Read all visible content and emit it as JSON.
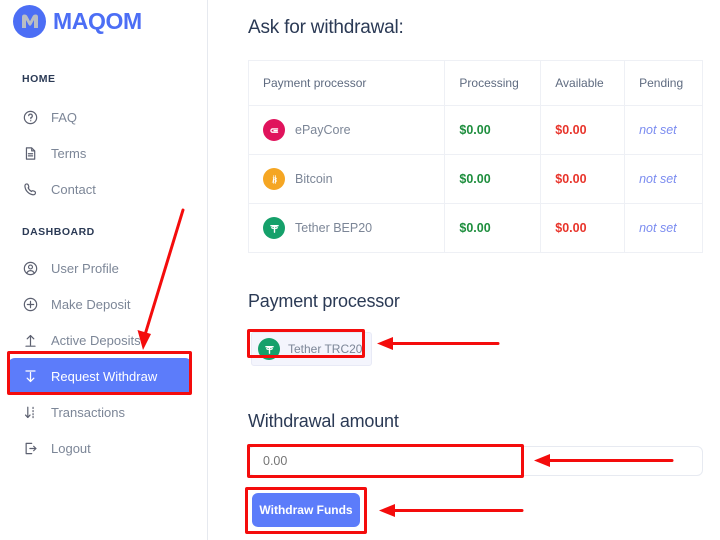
{
  "brand": {
    "name": "MAQOM",
    "logo_icon": "maqom-circle-m-logo",
    "color": "#4c6ef5"
  },
  "sidebar": {
    "sections": [
      {
        "label": "HOME",
        "items": [
          {
            "label": "FAQ",
            "icon": "question-circle-icon",
            "active": false
          },
          {
            "label": "Terms",
            "icon": "document-icon",
            "active": false
          },
          {
            "label": "Contact",
            "icon": "phone-icon",
            "active": false
          }
        ]
      },
      {
        "label": "DASHBOARD",
        "items": [
          {
            "label": "User Profile",
            "icon": "user-circle-icon",
            "active": false
          },
          {
            "label": "Make Deposit",
            "icon": "plus-circle-icon",
            "active": false
          },
          {
            "label": "Active Deposits",
            "icon": "upload-arrow-icon",
            "active": false
          },
          {
            "label": "Request Withdraw",
            "icon": "download-arrow-icon",
            "active": true
          },
          {
            "label": "Transactions",
            "icon": "transfer-arrows-icon",
            "active": false
          },
          {
            "label": "Logout",
            "icon": "logout-icon",
            "active": false
          }
        ]
      }
    ]
  },
  "main": {
    "page_title": "Ask for withdrawal:",
    "table": {
      "columns": [
        "Payment processor",
        "Processing",
        "Available",
        "Pending"
      ],
      "rows": [
        {
          "processor": "ePayCore",
          "icon": "epaycore-coin-icon",
          "icon_glyph": "e",
          "icon_color": "#e0135c",
          "processing": "$0.00",
          "available": "$0.00",
          "pending": "not set"
        },
        {
          "processor": "Bitcoin",
          "icon": "bitcoin-coin-icon",
          "icon_glyph": "Ƀ",
          "icon_color": "#f5a623",
          "processing": "$0.00",
          "available": "$0.00",
          "pending": "not set"
        },
        {
          "processor": "Tether BEP20",
          "icon": "tether-coin-icon",
          "icon_glyph": "₮",
          "icon_color": "#15a06a",
          "processing": "$0.00",
          "available": "$0.00",
          "pending": "not set"
        }
      ]
    },
    "processor_section": {
      "heading": "Payment processor",
      "selected": {
        "label": "Tether TRC20",
        "icon": "tether-coin-icon",
        "icon_glyph": "₮"
      }
    },
    "amount_section": {
      "heading": "Withdrawal amount",
      "input_placeholder": "0.00",
      "input_value": "",
      "submit_label": "Withdraw Funds"
    }
  },
  "annotations": {
    "color": "#f40c0c",
    "marks": [
      {
        "name": "highlight-request-withdraw",
        "type": "box"
      },
      {
        "name": "arrow-to-request-withdraw",
        "type": "arrow"
      },
      {
        "name": "highlight-tether-trc20-chip",
        "type": "box"
      },
      {
        "name": "arrow-to-tether-trc20-chip",
        "type": "arrow"
      },
      {
        "name": "highlight-amount-input",
        "type": "box"
      },
      {
        "name": "arrow-to-amount-input",
        "type": "arrow"
      },
      {
        "name": "highlight-withdraw-button",
        "type": "box"
      },
      {
        "name": "arrow-to-withdraw-button",
        "type": "arrow"
      }
    ]
  }
}
